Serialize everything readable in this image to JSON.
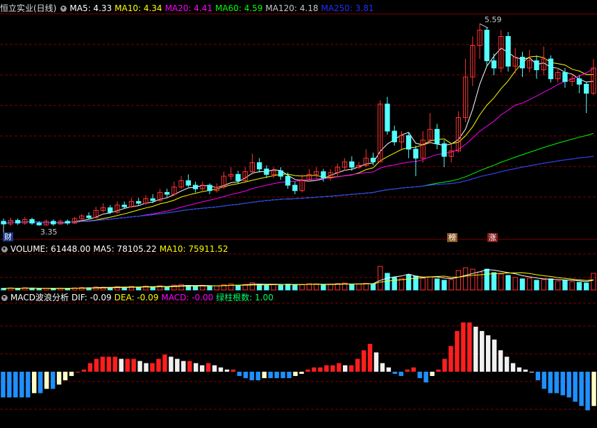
{
  "colors": {
    "up": "#ff3232",
    "down": "#54ffff",
    "ma5": "#ffffff",
    "ma10": "#ffff00",
    "ma20": "#ff00ff",
    "ma60": "#00ff00",
    "ma120": "#c8c8c8",
    "ma250": "#2030ff",
    "grid": "#800000",
    "white_bar": "#f0f0f0",
    "blue_bar": "#1e90ff",
    "pale_bar": "#ffffc8"
  },
  "kline_header": {
    "title": "恒立实业(日线)",
    "ma5": "MA5: 4.33",
    "ma10": "MA10: 4.34",
    "ma20": "MA20: 4.41",
    "ma60": "MA60: 4.59",
    "ma120": "MA120: 4.18",
    "ma250": "MA250: 3.81"
  },
  "volume_header": {
    "label": "VOLUME: 61448.00",
    "ma5": "MA5: 78105.22",
    "ma10": "MA10: 75911.52"
  },
  "macd_header": {
    "label": "MACD波浪分析",
    "dif": "DIF: -0.09",
    "dea": "DEA: -0.09",
    "macd": "MACD: -0.00",
    "green": "绿柱根数: 1.00"
  },
  "markers": {
    "high": "5.59",
    "low": "3.35",
    "tag_cai": "财",
    "tag_bang": "榜",
    "tag_zhang": "涨"
  },
  "chart_data": {
    "type": "candlestick",
    "price_range": [
      3.2,
      5.7
    ],
    "candles": [
      [
        3.4,
        3.37,
        3.43,
        3.35
      ],
      [
        3.37,
        3.41,
        3.44,
        3.35
      ],
      [
        3.41,
        3.38,
        3.43,
        3.36
      ],
      [
        3.38,
        3.42,
        3.45,
        3.36
      ],
      [
        3.42,
        3.38,
        3.44,
        3.36
      ],
      [
        3.38,
        3.36,
        3.4,
        3.35
      ],
      [
        3.36,
        3.4,
        3.42,
        3.35
      ],
      [
        3.4,
        3.37,
        3.42,
        3.35
      ],
      [
        3.37,
        3.4,
        3.42,
        3.36
      ],
      [
        3.4,
        3.38,
        3.42,
        3.36
      ],
      [
        3.38,
        3.43,
        3.45,
        3.37
      ],
      [
        3.43,
        3.46,
        3.48,
        3.4
      ],
      [
        3.46,
        3.44,
        3.5,
        3.42
      ],
      [
        3.44,
        3.52,
        3.56,
        3.43
      ],
      [
        3.52,
        3.55,
        3.6,
        3.5
      ],
      [
        3.55,
        3.5,
        3.58,
        3.48
      ],
      [
        3.5,
        3.58,
        3.62,
        3.48
      ],
      [
        3.58,
        3.56,
        3.62,
        3.54
      ],
      [
        3.56,
        3.62,
        3.66,
        3.55
      ],
      [
        3.62,
        3.6,
        3.66,
        3.58
      ],
      [
        3.6,
        3.65,
        3.69,
        3.58
      ],
      [
        3.65,
        3.63,
        3.7,
        3.6
      ],
      [
        3.63,
        3.72,
        3.76,
        3.62
      ],
      [
        3.72,
        3.7,
        3.76,
        3.67
      ],
      [
        3.7,
        3.78,
        3.84,
        3.68
      ],
      [
        3.78,
        3.85,
        3.9,
        3.76
      ],
      [
        3.85,
        3.8,
        3.92,
        3.78
      ],
      [
        3.8,
        3.76,
        3.84,
        3.72
      ],
      [
        3.76,
        3.8,
        3.84,
        3.74
      ],
      [
        3.8,
        3.74,
        3.82,
        3.7
      ],
      [
        3.74,
        3.78,
        3.82,
        3.72
      ],
      [
        3.78,
        3.9,
        3.95,
        3.76
      ],
      [
        3.9,
        3.92,
        4.0,
        3.86
      ],
      [
        3.92,
        3.85,
        3.96,
        3.82
      ],
      [
        3.85,
        3.95,
        4.0,
        3.84
      ],
      [
        3.95,
        4.05,
        4.15,
        3.92
      ],
      [
        4.05,
        3.98,
        4.1,
        3.94
      ],
      [
        3.98,
        3.92,
        4.02,
        3.88
      ],
      [
        3.92,
        3.96,
        4.0,
        3.88
      ],
      [
        3.96,
        3.9,
        4.0,
        3.86
      ],
      [
        3.9,
        3.8,
        3.94,
        3.76
      ],
      [
        3.8,
        3.74,
        3.84,
        3.7
      ],
      [
        3.74,
        3.86,
        3.92,
        3.72
      ],
      [
        3.86,
        3.92,
        3.98,
        3.84
      ],
      [
        3.92,
        3.95,
        4.0,
        3.88
      ],
      [
        3.95,
        3.88,
        3.98,
        3.84
      ],
      [
        3.88,
        3.94,
        3.98,
        3.85
      ],
      [
        3.94,
        4.0,
        4.04,
        3.9
      ],
      [
        4.0,
        4.06,
        4.1,
        3.96
      ],
      [
        4.06,
        4.0,
        4.12,
        3.96
      ],
      [
        4.0,
        4.02,
        4.06,
        3.98
      ],
      [
        4.02,
        4.1,
        4.2,
        4.0
      ],
      [
        4.1,
        4.06,
        4.16,
        4.02
      ],
      [
        4.06,
        4.7,
        4.74,
        4.05
      ],
      [
        4.7,
        4.4,
        4.78,
        4.36
      ],
      [
        4.4,
        4.28,
        4.46,
        4.24
      ],
      [
        4.28,
        4.35,
        4.4,
        4.2
      ],
      [
        4.35,
        4.2,
        4.38,
        4.1
      ],
      [
        4.2,
        4.1,
        4.24,
        3.9
      ],
      [
        4.1,
        4.3,
        4.4,
        4.05
      ],
      [
        4.3,
        4.42,
        4.6,
        4.26
      ],
      [
        4.42,
        4.26,
        4.48,
        4.2
      ],
      [
        4.26,
        4.12,
        4.3,
        4.0
      ],
      [
        4.12,
        4.18,
        4.26,
        4.05
      ],
      [
        4.18,
        4.55,
        4.62,
        4.16
      ],
      [
        4.55,
        5.0,
        5.2,
        4.5
      ],
      [
        5.0,
        5.35,
        5.45,
        4.9
      ],
      [
        5.35,
        5.52,
        5.59,
        5.2
      ],
      [
        5.52,
        5.18,
        5.55,
        5.12
      ],
      [
        5.18,
        5.1,
        5.26,
        5.02
      ],
      [
        5.1,
        5.45,
        5.52,
        5.05
      ],
      [
        5.45,
        5.12,
        5.5,
        5.06
      ],
      [
        5.12,
        5.22,
        5.32,
        5.04
      ],
      [
        5.22,
        5.1,
        5.28,
        5.0
      ],
      [
        5.1,
        5.18,
        5.3,
        5.05
      ],
      [
        5.18,
        5.08,
        5.24,
        4.98
      ],
      [
        5.08,
        5.2,
        5.34,
        5.02
      ],
      [
        5.2,
        4.98,
        5.24,
        4.94
      ],
      [
        4.98,
        5.05,
        5.1,
        4.94
      ],
      [
        5.05,
        4.95,
        5.1,
        4.88
      ],
      [
        4.95,
        4.98,
        5.04,
        4.9
      ],
      [
        4.98,
        4.92,
        5.02,
        4.82
      ],
      [
        4.92,
        4.82,
        4.95,
        4.6
      ],
      [
        4.82,
        5.1,
        5.2,
        4.8
      ]
    ],
    "volume_range": [
      0,
      260000
    ],
    "volume": [
      12000,
      14000,
      10000,
      16000,
      13000,
      9000,
      12000,
      11000,
      13000,
      10000,
      15000,
      18000,
      16000,
      22000,
      20000,
      17000,
      24000,
      20000,
      26000,
      21000,
      28000,
      22000,
      30000,
      24000,
      35000,
      40000,
      33000,
      28000,
      30000,
      26000,
      30000,
      38000,
      44000,
      34000,
      40000,
      52000,
      42000,
      36000,
      38000,
      34000,
      42000,
      40000,
      38000,
      45000,
      44000,
      38000,
      42000,
      46000,
      50000,
      40000,
      42000,
      48000,
      45000,
      170000,
      120000,
      90000,
      80000,
      110000,
      100000,
      85000,
      95000,
      80000,
      70000,
      75000,
      140000,
      160000,
      150000,
      130000,
      150000,
      125000,
      115000,
      105000,
      90000,
      80000,
      85000,
      70000,
      75000,
      80000,
      65000,
      70000,
      60000,
      55000,
      50000,
      120000
    ],
    "volume_ma5_line": [
      19000,
      19500,
      20000,
      21000,
      22000,
      23000,
      24000,
      25000,
      26000,
      27000,
      28000,
      30000,
      32000,
      34000,
      36000,
      38000,
      40000,
      45000,
      60000,
      75000,
      85000,
      95000,
      100000,
      98000,
      90000,
      88000,
      86000,
      85000,
      95000,
      110000,
      120000,
      125000,
      115000,
      105000,
      95000,
      85000,
      78000,
      76000,
      78000
    ],
    "macd_range": [
      -0.12,
      0.16
    ],
    "macd": [
      -0.06,
      -0.06,
      -0.06,
      -0.06,
      -0.06,
      -0.05,
      -0.05,
      -0.04,
      -0.04,
      -0.03,
      -0.02,
      -0.01,
      0.0,
      0.005,
      0.02,
      0.03,
      0.035,
      0.035,
      0.035,
      0.03,
      0.03,
      0.03,
      0.025,
      0.02,
      0.02,
      0.03,
      0.04,
      0.035,
      0.03,
      0.025,
      0.025,
      0.02,
      0.015,
      0.02,
      0.015,
      0.01,
      0.005,
      0.005,
      -0.01,
      -0.015,
      -0.02,
      -0.02,
      -0.015,
      -0.015,
      -0.015,
      -0.015,
      -0.015,
      -0.01,
      -0.005,
      0.005,
      0.01,
      0.01,
      0.015,
      0.015,
      0.02,
      0.015,
      0.015,
      0.03,
      0.05,
      0.065,
      0.045,
      0.02,
      0.01,
      -0.005,
      -0.01,
      0.005,
      0.01,
      -0.015,
      -0.025,
      -0.01,
      0.005,
      0.03,
      0.06,
      0.095,
      0.115,
      0.115,
      0.105,
      0.095,
      0.085,
      0.075,
      0.05,
      0.035,
      0.02,
      0.01,
      0.005,
      0.0,
      -0.02,
      -0.04,
      -0.05,
      -0.05,
      -0.055,
      -0.06,
      -0.07,
      -0.08,
      -0.09,
      -0.08
    ]
  }
}
